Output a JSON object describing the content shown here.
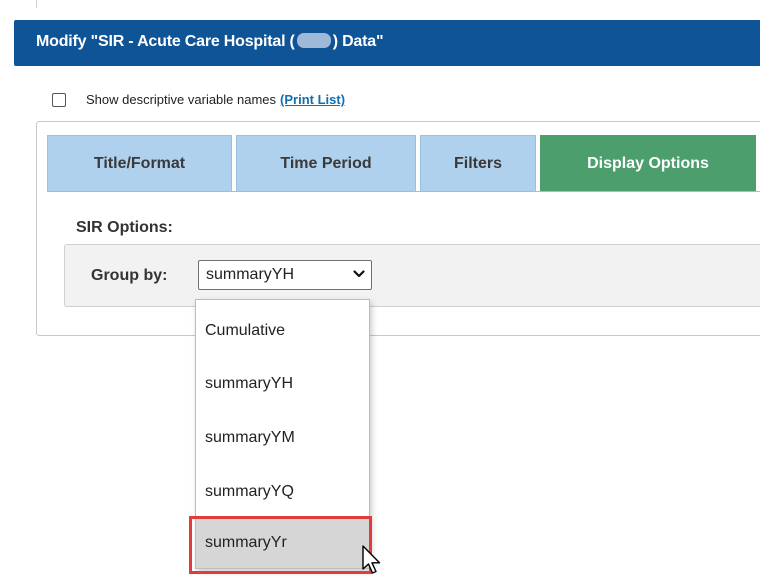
{
  "dialog": {
    "title_prefix": "Modify \"SIR - Acute Care Hospital (",
    "title_suffix": ") Data\""
  },
  "descriptive": {
    "label": "Show descriptive variable names",
    "link": "(Print List)",
    "checked": false
  },
  "tabs": [
    {
      "label": "Title/Format",
      "active": false
    },
    {
      "label": "Time Period",
      "active": false
    },
    {
      "label": "Filters",
      "active": false
    },
    {
      "label": "Display Options",
      "active": true
    }
  ],
  "sir_options": {
    "label": "SIR Options:",
    "group_by_label": "Group by:",
    "selected": "summaryYH"
  },
  "dropdown": {
    "options": [
      "Cumulative",
      "summaryYH",
      "summaryYM",
      "summaryYQ",
      "summaryYr"
    ],
    "hovered": "summaryYr"
  },
  "colors": {
    "title_bar": "#0f5497",
    "tab_inactive": "#b0d1ee",
    "tab_active": "#4c9e6d",
    "link": "#0f6fb3",
    "highlight": "#e23b3b"
  },
  "icons": {
    "select_arrow": "chevron-down-icon",
    "cursor": "mouse-pointer-icon",
    "redaction": "redaction-mark"
  }
}
